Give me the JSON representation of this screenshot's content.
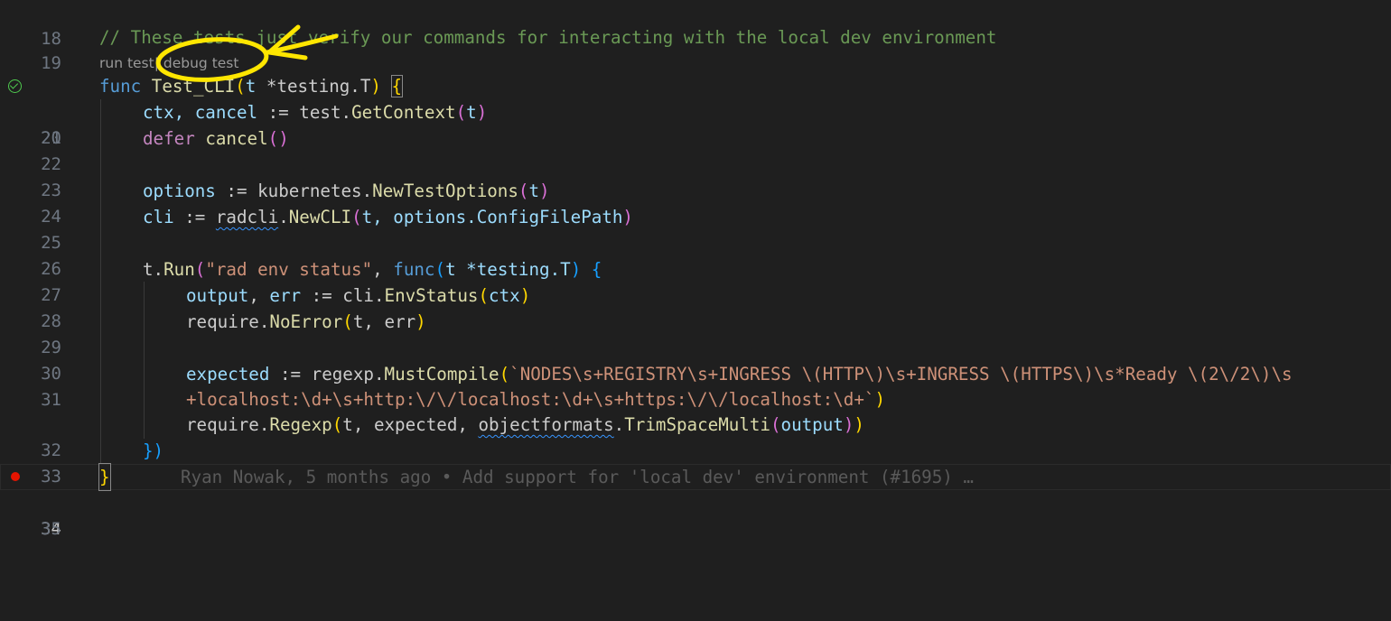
{
  "editor": {
    "codelens": {
      "run_test": "run test",
      "separator": "|",
      "debug_test": "debug test"
    },
    "blame": "Ryan Nowak, 5 months ago • Add support for 'local dev' environment (#1695) …",
    "line_numbers": [
      "18",
      "19",
      "20",
      "21",
      "22",
      "23",
      "24",
      "25",
      "26",
      "27",
      "28",
      "29",
      "30",
      "31",
      "32",
      "33",
      "34",
      "35"
    ],
    "code": {
      "l19_comment": "// These tests just verify our commands for interacting with the local dev environment",
      "l20": {
        "kw": "func",
        "name": "Test_CLI",
        "param": "t",
        "type": "*testing.T"
      },
      "l21": {
        "vars": "ctx, cancel",
        "op": " := ",
        "pkg": "test.",
        "fn": "GetContext",
        "arg": "t"
      },
      "l22": {
        "kw": "defer",
        "fn": "cancel"
      },
      "l24": {
        "var": "options",
        "op": " := ",
        "pkg": "kubernetes.",
        "fn": "NewTestOptions",
        "arg": "t"
      },
      "l25": {
        "var": "cli",
        "op": " := ",
        "pkg": "radcli",
        "dot": ".",
        "fn": "NewCLI",
        "args": "t, options.ConfigFilePath"
      },
      "l27": {
        "pre": "t.",
        "fn": "Run",
        "str": "\"rad env status\"",
        "comma": ", ",
        "kw": "func",
        "param": "t *testing.T",
        "brace": " {"
      },
      "l28": {
        "vars": "output",
        "mid": ", ",
        "var2": "err",
        "op": " := ",
        "pkg": "cli.",
        "fn": "EnvStatus",
        "arg": "ctx"
      },
      "l29": {
        "pkg": "require.",
        "fn": "NoError",
        "args": "t, err"
      },
      "l31a": {
        "var": "expected",
        "op": " := ",
        "pkg": "regexp.",
        "fn": "MustCompile",
        "str": "`NODES\\s+REGISTRY\\s+INGRESS \\(HTTP\\)\\s+INGRESS \\(HTTPS\\)\\s*Ready \\(2\\/2\\)\\s"
      },
      "l31b": {
        "str": "+localhost:\\d+\\s+http:\\/\\/localhost:\\d+\\s+https:\\/\\/localhost:\\d+`"
      },
      "l32": {
        "pkg": "require.",
        "fn": "Regexp",
        "args": "t, expected, ",
        "pkg2": "objectformats",
        "dot": ".",
        "fn2": "TrimSpaceMulti",
        "arg": "output"
      },
      "l33": "})",
      "l34": "}"
    },
    "colors": {
      "background": "#1f1f1f",
      "comment": "#6a9955",
      "keyword": "#569cd6",
      "control": "#c586c0",
      "function": "#dcdcaa",
      "variable": "#9cdcfe",
      "string": "#ce9178",
      "annotation": "#ffe600",
      "breakpoint": "#e51400",
      "test_pass": "#4ec94e"
    },
    "icons": {
      "test_status": "check-circle-icon",
      "breakpoint": "breakpoint-icon"
    }
  }
}
